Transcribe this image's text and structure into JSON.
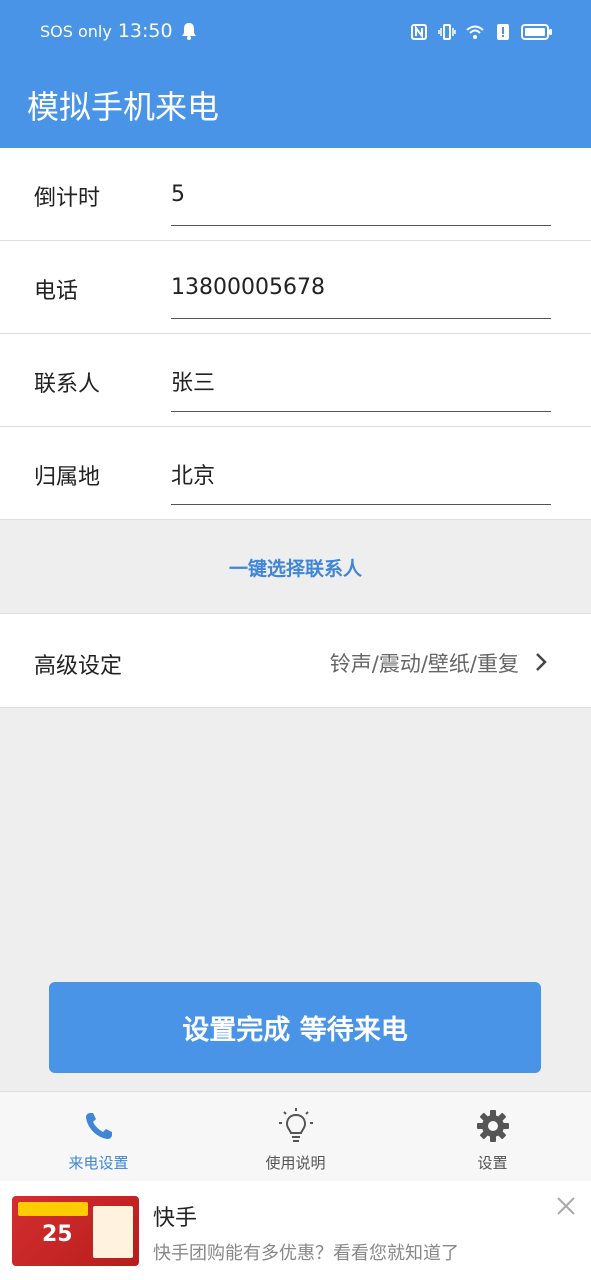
{
  "status_bar": {
    "carrier": "SOS only",
    "time": "13:50"
  },
  "app_bar": {
    "title": "模拟手机来电"
  },
  "form": {
    "countdown": {
      "label": "倒计时",
      "value": "5"
    },
    "phone": {
      "label": "电话",
      "value": "13800005678"
    },
    "contact": {
      "label": "联系人",
      "value": "张三"
    },
    "location": {
      "label": "归属地",
      "value": "北京"
    }
  },
  "pick_contact_label": "一键选择联系人",
  "advanced": {
    "label": "高级设定",
    "value": "铃声/震动/壁纸/重复"
  },
  "main_button_label": "设置完成 等待来电",
  "tabs": [
    {
      "label": "来电设置",
      "icon": "phone-icon",
      "active": true
    },
    {
      "label": "使用说明",
      "icon": "lightbulb-icon",
      "active": false
    },
    {
      "label": "设置",
      "icon": "gear-icon",
      "active": false
    }
  ],
  "ad": {
    "thumb_text": "25",
    "title": "快手",
    "description": "快手团购能有多优惠？看看您就知道了"
  },
  "colors": {
    "primary": "#4a94e8",
    "link": "#3f86d6",
    "background": "#eeeeee"
  }
}
